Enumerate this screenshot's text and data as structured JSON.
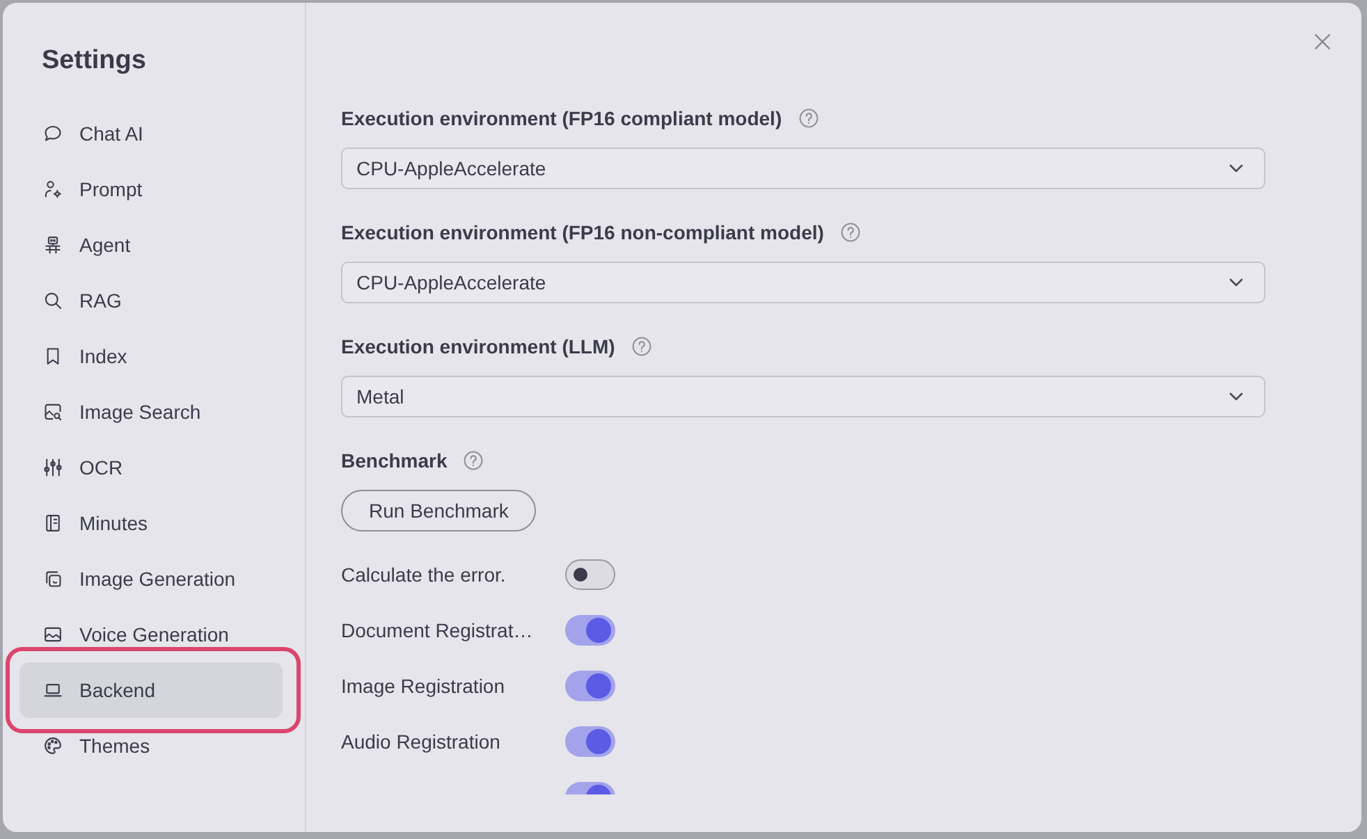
{
  "window": {
    "title": "Settings"
  },
  "sidebar": {
    "items": [
      {
        "label": "Chat AI",
        "selected": false,
        "highlighted": false
      },
      {
        "label": "Prompt",
        "selected": false,
        "highlighted": false
      },
      {
        "label": "Agent",
        "selected": false,
        "highlighted": false
      },
      {
        "label": "RAG",
        "selected": false,
        "highlighted": false
      },
      {
        "label": "Index",
        "selected": false,
        "highlighted": false
      },
      {
        "label": "Image Search",
        "selected": false,
        "highlighted": false
      },
      {
        "label": "OCR",
        "selected": false,
        "highlighted": false
      },
      {
        "label": "Minutes",
        "selected": false,
        "highlighted": false
      },
      {
        "label": "Image Generation",
        "selected": false,
        "highlighted": false
      },
      {
        "label": "Voice Generation",
        "selected": false,
        "highlighted": false
      },
      {
        "label": "Backend",
        "selected": true,
        "highlighted": true
      },
      {
        "label": "Themes",
        "selected": false,
        "highlighted": false
      }
    ]
  },
  "fields": [
    {
      "label": "Execution environment (FP16 compliant model)",
      "value": "CPU-AppleAccelerate"
    },
    {
      "label": "Execution environment (FP16 non-compliant model)",
      "value": "CPU-AppleAccelerate"
    },
    {
      "label": "Execution environment (LLM)",
      "value": "Metal"
    }
  ],
  "benchmark": {
    "label": "Benchmark",
    "button": "Run Benchmark"
  },
  "toggles": [
    {
      "label": "Calculate the error.",
      "on": false
    },
    {
      "label": "Document Registrat…",
      "on": true
    },
    {
      "label": "Image Registration",
      "on": true
    },
    {
      "label": "Audio Registration",
      "on": true
    },
    {
      "on": true
    }
  ]
}
